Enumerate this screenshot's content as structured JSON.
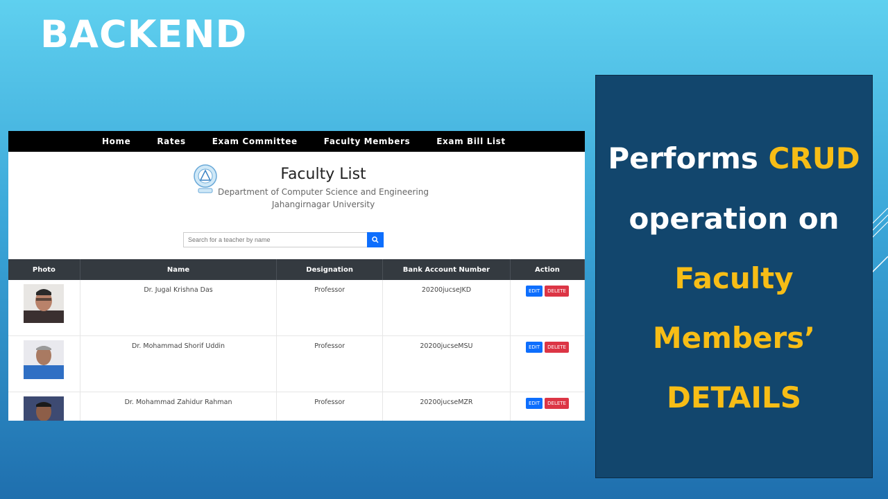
{
  "slide": {
    "title": "BACKEND"
  },
  "nav": {
    "items": [
      "Home",
      "Rates",
      "Exam Committee",
      "Faculty Members",
      "Exam Bill List"
    ]
  },
  "page": {
    "title": "Faculty List",
    "department": "Department of Computer Science and Engineering",
    "university": "Jahangirnagar University"
  },
  "search": {
    "placeholder": "Search for a teacher by name",
    "icon": "search-icon"
  },
  "table": {
    "headers": [
      "Photo",
      "Name",
      "Designation",
      "Bank Account Number",
      "Action"
    ],
    "rows": [
      {
        "name": "Dr. Jugal Krishna Das",
        "designation": "Professor",
        "account": "20200jucseJKD",
        "edit": "EDIT",
        "delete": "DELETE"
      },
      {
        "name": "Dr. Mohammad Shorif Uddin",
        "designation": "Professor",
        "account": "20200jucseMSU",
        "edit": "EDIT",
        "delete": "DELETE"
      },
      {
        "name": "Dr. Mohammad Zahidur Rahman",
        "designation": "Professor",
        "account": "20200jucseMZR",
        "edit": "EDIT",
        "delete": "DELETE"
      }
    ]
  },
  "info": {
    "line1_a": "Performs",
    "line1_b": "CRUD",
    "line2": "operation on",
    "line3": "Faculty",
    "line4": "Members’",
    "line5": "DETAILS"
  },
  "colors": {
    "accent_gold": "#f7bd16",
    "panel": "#12466d",
    "edit": "#0d6efd",
    "delete": "#dc3545"
  }
}
